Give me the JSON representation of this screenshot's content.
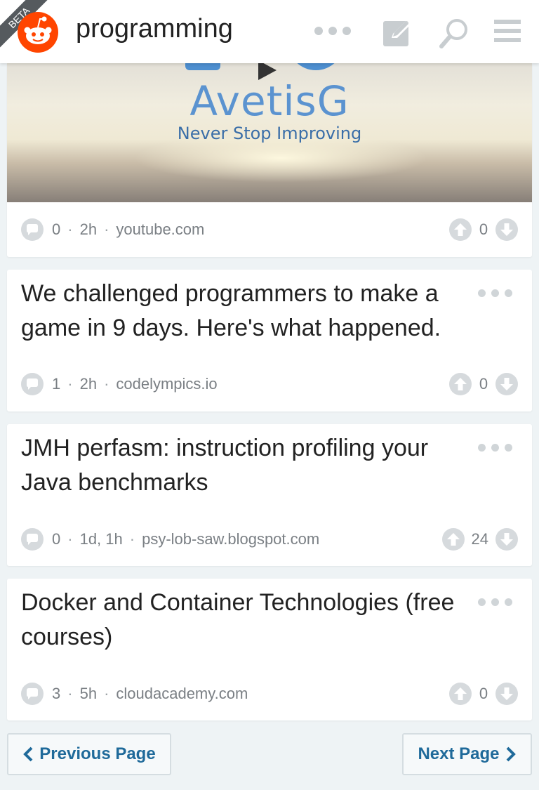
{
  "header": {
    "beta_label": "BETA",
    "subreddit": "programming",
    "icons": [
      "reddit-alien-logo",
      "more-dots-icon",
      "compose-icon",
      "search-icon",
      "menu-icon"
    ]
  },
  "video_card": {
    "thumbnail": {
      "brand_name": "AvetisG",
      "tagline": "Never Stop Improving"
    },
    "comments": "0",
    "age": "2h",
    "domain": "youtube.com",
    "score": "0"
  },
  "posts": [
    {
      "title": "We challenged programmers to make a game in 9 days. Here's what happened.",
      "comments": "1",
      "age": "2h",
      "domain": "codelympics.io",
      "score": "0"
    },
    {
      "title": "JMH perfasm: instruction profiling your Java benchmarks",
      "comments": "0",
      "age": "1d, 1h",
      "domain": "psy-lob-saw.blogspot.com",
      "score": "24"
    },
    {
      "title": "Docker and Container Technologies (free courses)",
      "comments": "3",
      "age": "5h",
      "domain": "cloudacademy.com",
      "score": "0"
    }
  ],
  "pagination": {
    "prev_label": "Previous Page",
    "next_label": "Next Page"
  },
  "colors": {
    "accent": "#1f6a9a",
    "reddit_orange": "#ff4500",
    "background": "#eef3f5"
  }
}
